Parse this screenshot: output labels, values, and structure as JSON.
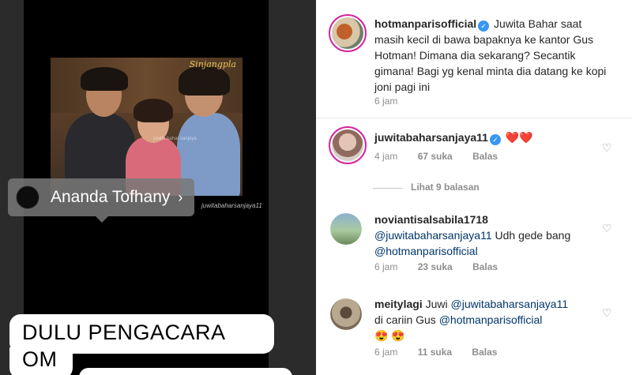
{
  "story": {
    "photo_brand": "Sinjangpla",
    "photo_watermark": "juwita bahar sanjaya",
    "photo_caption": "juwitabaharsanjaya11",
    "mention_name": "Ananda Tofhany",
    "mention_chevron": "›",
    "sticker_line1": "DULU PENGACARA AKU",
    "sticker_line2": "OM"
  },
  "caption": {
    "username": "hotmanparisofficial",
    "verified_icon": "✓",
    "text": "Juwita Bahar saat masih kecil di bawa bapaknya ke kantor Gus Hotman! Dimana dia sekarang? Secantik gimana! Bagi yg kenal minta dia datang ke kopi joni pagi ini",
    "time": "6 jam"
  },
  "comments": [
    {
      "username": "juwitabaharsanjaya11",
      "verified_icon": "✓",
      "text": "❤️❤️",
      "time": "4 jam",
      "likes": "67 suka",
      "reply": "Balas"
    },
    {
      "view_replies": "Lihat 9 balasan"
    },
    {
      "username": "noviantisalsabila1718",
      "mention1": "@juwitabaharsanjaya11",
      "text1": " Udh gede bang ",
      "mention2": "@hotmanparisofficial",
      "time": "6 jam",
      "likes": "23 suka",
      "reply": "Balas"
    },
    {
      "username": "meitylagi",
      "text1": " Juwi ",
      "mention1": "@juwitabaharsanjaya11",
      "text2": " di cariin Gus ",
      "mention2": "@hotmanparisofficial",
      "emoji": "😍 😍",
      "time": "6 jam",
      "likes": "11 suka",
      "reply": "Balas"
    }
  ],
  "icons": {
    "heart": "♡"
  }
}
